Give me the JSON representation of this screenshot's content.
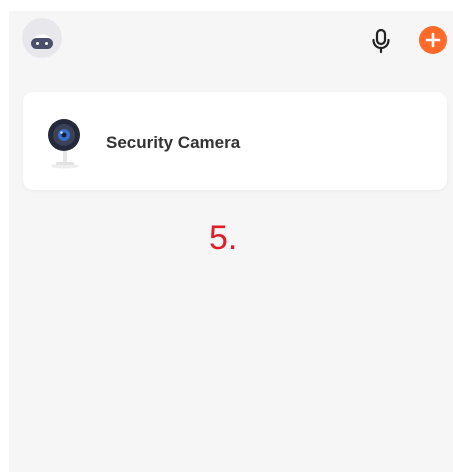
{
  "header": {
    "avatar_icon": "robot-avatar-icon",
    "mic_icon": "microphone-icon",
    "add_icon": "plus-circle-icon",
    "accent_color": "#ff6a2b"
  },
  "devices": [
    {
      "name": "Security Camera",
      "icon": "security-camera-icon"
    }
  ],
  "annotation": {
    "step_label": "5.",
    "color": "#e01e2b"
  }
}
